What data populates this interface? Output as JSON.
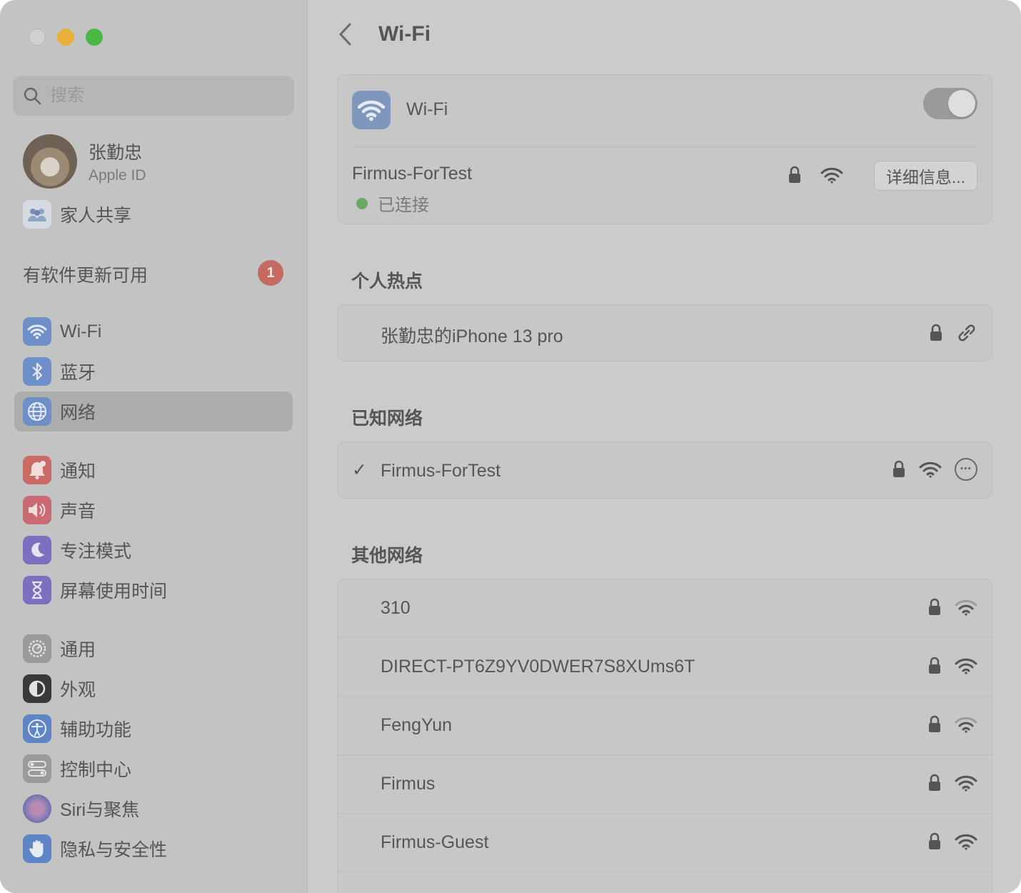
{
  "sidebar": {
    "search_placeholder": "搜索",
    "account": {
      "name": "张勤忠",
      "subtitle": "Apple ID"
    },
    "family": {
      "label": "家人共享"
    },
    "update": {
      "label": "有软件更新可用",
      "badge": "1"
    },
    "items": [
      {
        "label": "Wi-Fi",
        "icon": "wifi-icon",
        "color": "#6f8fc9"
      },
      {
        "label": "蓝牙",
        "icon": "bluetooth-icon",
        "color": "#6f8fc9"
      },
      {
        "label": "网络",
        "icon": "globe-icon",
        "color": "#6f8fc9"
      },
      {
        "label": "通知",
        "icon": "bell-icon",
        "color": "#c96a64"
      },
      {
        "label": "声音",
        "icon": "speaker-icon",
        "color": "#c96a74"
      },
      {
        "label": "专注模式",
        "icon": "moon-icon",
        "color": "#7d6fc0"
      },
      {
        "label": "屏幕使用时间",
        "icon": "hourglass-icon",
        "color": "#7d6fc0"
      },
      {
        "label": "通用",
        "icon": "gear-icon",
        "color": "#9a9a9a"
      },
      {
        "label": "外观",
        "icon": "appearance-icon",
        "color": "#3a3a3a"
      },
      {
        "label": "辅助功能",
        "icon": "accessibility-icon",
        "color": "#5e86c7"
      },
      {
        "label": "控制中心",
        "icon": "control-center-icon",
        "color": "#9a9a9a"
      },
      {
        "label": "Siri与聚焦",
        "icon": "siri-icon",
        "color": "#7b7bb8"
      },
      {
        "label": "隐私与安全性",
        "icon": "hand-icon",
        "color": "#5e86c7"
      }
    ]
  },
  "main": {
    "title": "Wi-Fi",
    "wifi_card": {
      "label": "Wi-Fi",
      "toggle_on": true,
      "current_network": "Firmus-ForTest",
      "status": "已连接",
      "details_label": "详细信息..."
    },
    "hotspot": {
      "title": "个人热点",
      "device": "张勤忠的iPhone 13 pro"
    },
    "known": {
      "title": "已知网络",
      "network": "Firmus-ForTest",
      "check": "✓"
    },
    "other": {
      "title": "其他网络",
      "networks": [
        {
          "name": "310",
          "signal": "weak"
        },
        {
          "name": "DIRECT-PT6Z9YV0DWER7S8XUms6T",
          "signal": "strong"
        },
        {
          "name": "FengYun",
          "signal": "weak"
        },
        {
          "name": "Firmus",
          "signal": "strong"
        },
        {
          "name": "Firmus-Guest",
          "signal": "strong"
        }
      ]
    }
  }
}
